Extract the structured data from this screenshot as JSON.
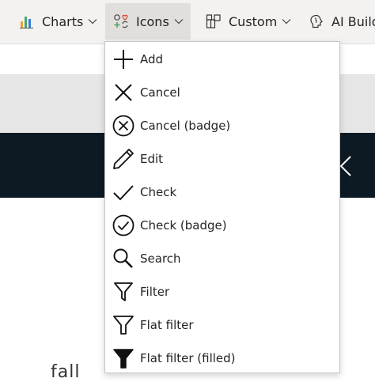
{
  "ribbon": {
    "items": [
      {
        "label": "Charts",
        "icon": "chart-icon"
      },
      {
        "label": "Icons",
        "icon": "icons-icon",
        "active": true
      },
      {
        "label": "Custom",
        "icon": "custom-icon"
      },
      {
        "label": "AI Build",
        "icon": "ai-brain-icon"
      }
    ]
  },
  "page": {
    "partial_text": "fall"
  },
  "dropdown": {
    "items": [
      {
        "label": "Add",
        "icon": "plus-icon"
      },
      {
        "label": "Cancel",
        "icon": "x-icon"
      },
      {
        "label": "Cancel (badge)",
        "icon": "x-circle-icon"
      },
      {
        "label": "Edit",
        "icon": "pencil-icon"
      },
      {
        "label": "Check",
        "icon": "check-icon"
      },
      {
        "label": "Check (badge)",
        "icon": "check-circle-icon"
      },
      {
        "label": "Search",
        "icon": "magnifier-icon"
      },
      {
        "label": "Filter",
        "icon": "filter-icon"
      },
      {
        "label": "Flat filter",
        "icon": "flat-filter-icon"
      },
      {
        "label": "Flat filter (filled)",
        "icon": "flat-filter-filled-icon"
      }
    ]
  },
  "colors": {
    "ribbon_bg": "#f3f2f1",
    "active_tab_bg": "#e1dfdd",
    "dark_header": "#0d1a24",
    "text": "#252423"
  }
}
